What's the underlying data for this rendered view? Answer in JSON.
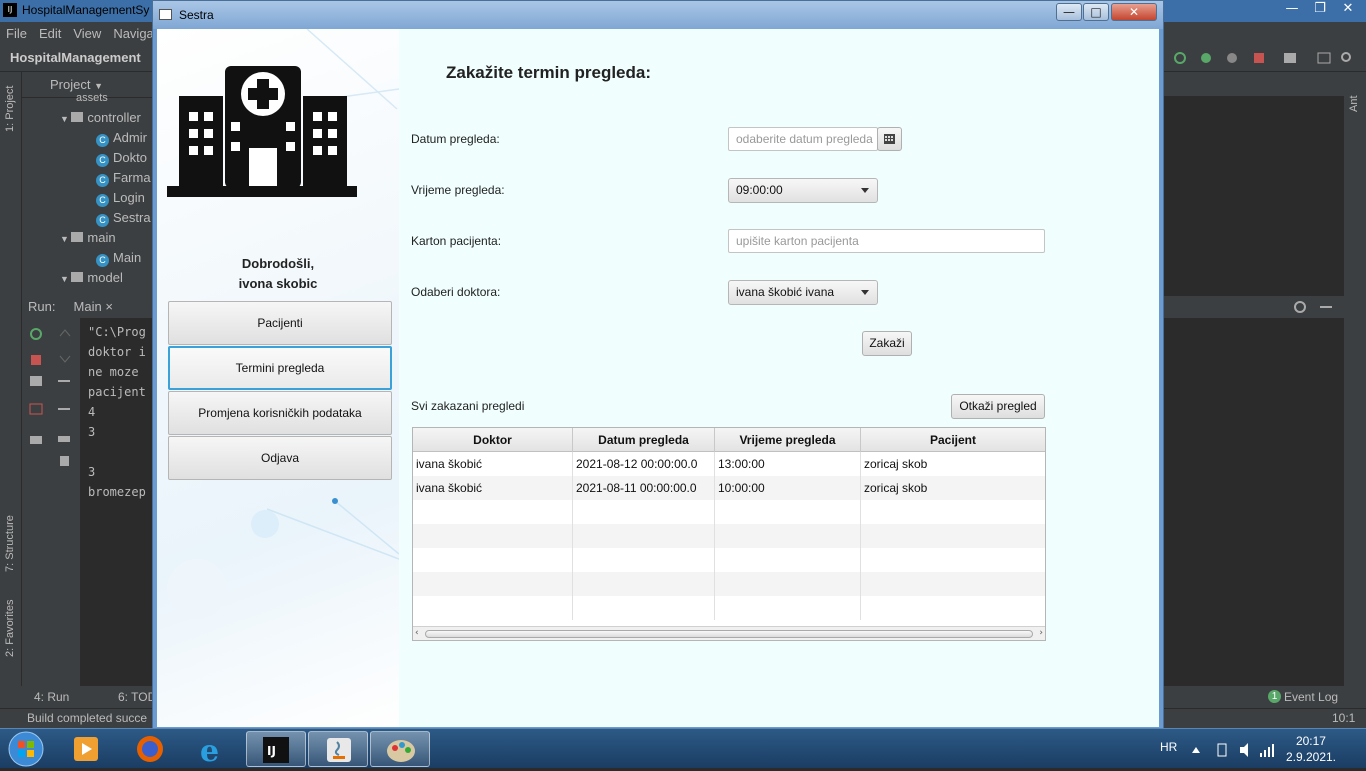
{
  "ide": {
    "title": "HospitalManagementSy",
    "menu": [
      "File",
      "Edit",
      "View",
      "Navigat"
    ],
    "breadcrumb": "HospitalManagement",
    "project_label": "Project",
    "tree": [
      "assets",
      "controller",
      "Admir",
      "Dokto",
      "Farma",
      "Login",
      "Sestra",
      "main",
      "Main",
      "model"
    ],
    "run_label": "Run:",
    "run_tab": "Main",
    "console": [
      "\"C:\\Prog",
      "doktor i",
      "ne moze",
      "pacijent",
      "4",
      "3",
      "",
      "3",
      "bromezep"
    ],
    "left_strip": [
      "1: Project",
      "7: Structure",
      "2: Favorites"
    ],
    "right_strip": "Ant",
    "bottom_tabs": [
      "4: Run",
      "6: TOD"
    ],
    "event_log": "Event Log",
    "event_count": "1",
    "status": "Build completed succe",
    "caret": "10:1"
  },
  "window": {
    "title": "Sestra"
  },
  "sidebar": {
    "welcome_line1": "Dobrodošli,",
    "welcome_line2": "ivona skobic",
    "buttons": [
      "Pacijenti",
      "Termini pregleda",
      "Promjena korisničkih podataka",
      "Odjava"
    ]
  },
  "form": {
    "heading": "Zakažite termin pregleda:",
    "date_label": "Datum pregleda:",
    "date_placeholder": "odaberite datum pregleda",
    "time_label": "Vrijeme pregleda:",
    "time_value": "09:00:00",
    "card_label": "Karton pacijenta:",
    "card_placeholder": "upišite karton pacijenta",
    "doctor_label": "Odaberi doktora:",
    "doctor_value": "ivana škobić ivana",
    "submit_label": "Zakaži"
  },
  "appointments": {
    "title": "Svi zakazani pregledi",
    "cancel_label": "Otkaži pregled",
    "columns": [
      "Doktor",
      "Datum pregleda",
      "Vrijeme pregleda",
      "Pacijent"
    ],
    "rows": [
      [
        "ivana škobić",
        "2021-08-12 00:00:00.0",
        "13:00:00",
        "zoricaj skob"
      ],
      [
        "ivana škobić",
        "2021-08-11 00:00:00.0",
        "10:00:00",
        "zoricaj skob"
      ]
    ]
  },
  "taskbar": {
    "language": "HR",
    "time": "20:17",
    "date": "2.9.2021."
  }
}
